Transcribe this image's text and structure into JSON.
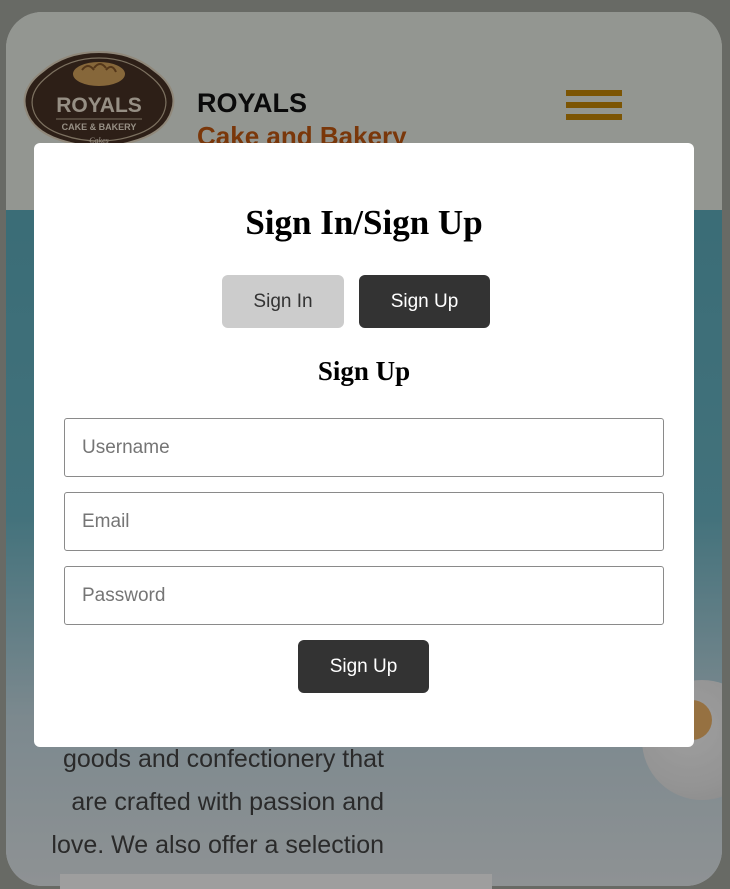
{
  "header": {
    "logo": {
      "text_main": "ROYALS",
      "text_sub": "CAKE & BAKERY",
      "text_script": "Cakes",
      "colors": {
        "badge": "#4a3326",
        "text": "#f3e7d6",
        "bread": "#d9a75e"
      }
    },
    "brand_name": "ROYALS",
    "brand_tagline": "Cake and Bakery",
    "menu_icon": "hamburger-menu-icon",
    "accent_color": "#c98a08"
  },
  "hero": {
    "text": "goods and confectionery that are crafted with passion and love. We also offer a selection of"
  },
  "modal": {
    "title": "Sign In/Sign Up",
    "tabs": [
      {
        "label": "Sign In",
        "active": false
      },
      {
        "label": "Sign Up",
        "active": true
      }
    ],
    "form_title": "Sign Up",
    "fields": {
      "username": {
        "placeholder": "Username",
        "value": ""
      },
      "email": {
        "placeholder": "Email",
        "value": ""
      },
      "password": {
        "placeholder": "Password",
        "value": ""
      }
    },
    "submit_label": "Sign Up",
    "colors": {
      "dark_button": "#333333",
      "inactive_tab": "#cccccc"
    }
  }
}
